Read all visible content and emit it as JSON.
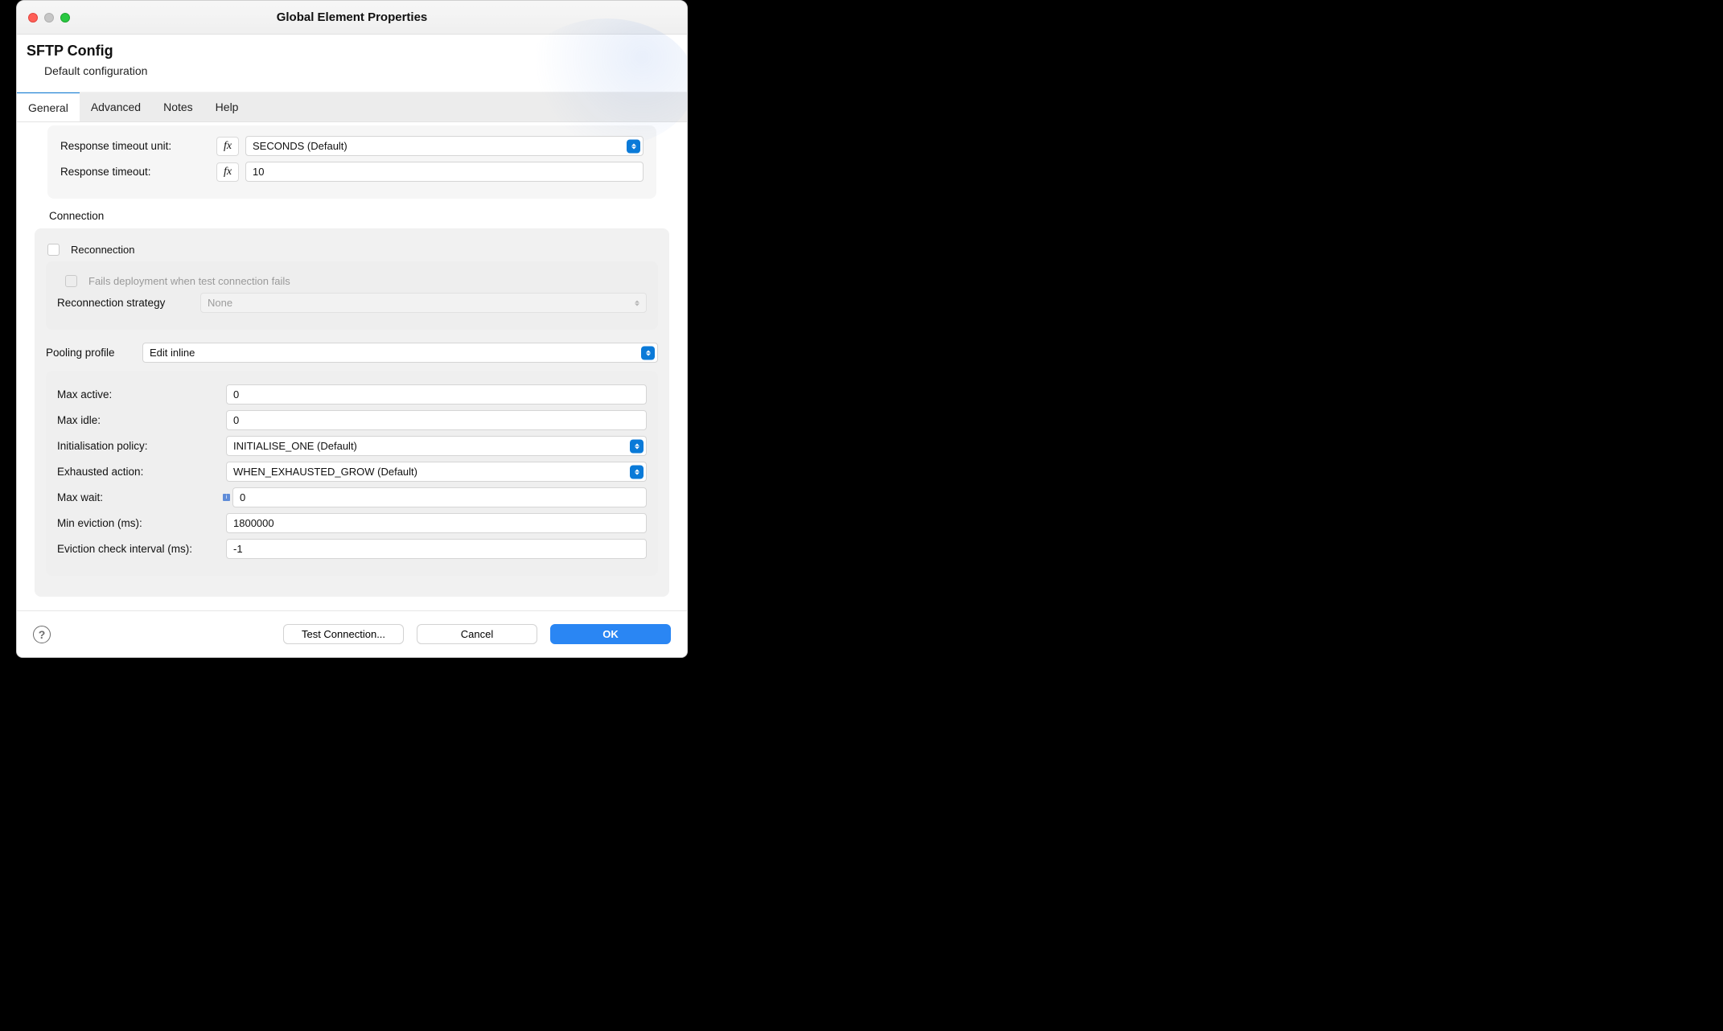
{
  "window": {
    "title": "Global Element Properties"
  },
  "header": {
    "title": "SFTP Config",
    "subtitle": "Default configuration"
  },
  "tabs": {
    "t0": "General",
    "t1": "Advanced",
    "t2": "Notes",
    "t3": "Help"
  },
  "top": {
    "resp_timeout_unit_lbl": "Response timeout unit:",
    "resp_timeout_unit_val": "SECONDS (Default)",
    "resp_timeout_lbl": "Response timeout:",
    "resp_timeout_val": "10",
    "fx": "fx"
  },
  "conn": {
    "section": "Connection",
    "reconn_lbl": "Reconnection",
    "fails_lbl": "Fails deployment when test connection fails",
    "strategy_lbl": "Reconnection strategy",
    "strategy_val": "None"
  },
  "pool": {
    "profile_lbl": "Pooling profile",
    "profile_val": "Edit inline",
    "max_active_lbl": "Max active:",
    "max_active_val": "0",
    "max_idle_lbl": "Max idle:",
    "max_idle_val": "0",
    "init_policy_lbl": "Initialisation policy:",
    "init_policy_val": "INITIALISE_ONE (Default)",
    "exhausted_lbl": "Exhausted action:",
    "exhausted_val": "WHEN_EXHAUSTED_GROW (Default)",
    "max_wait_lbl": "Max wait:",
    "max_wait_val": "0",
    "min_evict_lbl": "Min eviction (ms):",
    "min_evict_val": "1800000",
    "evict_int_lbl": "Eviction check interval (ms):",
    "evict_int_val": "-1"
  },
  "footer": {
    "test": "Test Connection...",
    "cancel": "Cancel",
    "ok": "OK"
  },
  "icons": {
    "info": "i"
  }
}
